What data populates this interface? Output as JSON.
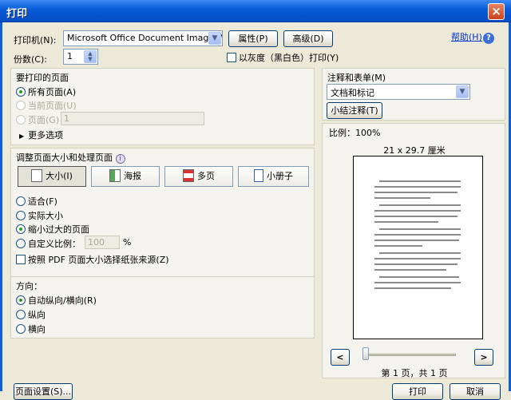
{
  "window": {
    "title": "打印",
    "close": "×"
  },
  "printer": {
    "label": "打印机(N):",
    "value": "Microsoft Office Document Image Writer",
    "properties": "属性(P)",
    "advanced": "高级(D)",
    "help": "帮助(H)"
  },
  "copies": {
    "label": "份数(C):",
    "value": "1"
  },
  "grayscale": {
    "label": "以灰度（黑白色）打印(Y)"
  },
  "pages": {
    "title": "要打印的页面",
    "all": "所有页面(A)",
    "current": "当前页面(U)",
    "range": "页面(G)",
    "range_value": "1",
    "more": "更多选项"
  },
  "sizing": {
    "title": "调整页面大小和处理页面",
    "tiles": [
      "大小(I)",
      "海报",
      "多页",
      "小册子"
    ],
    "fit": "适合(F)",
    "actual": "实际大小",
    "shrink": "缩小过大的页面",
    "custom": "自定义比例：",
    "custom_value": "100",
    "percent": "%",
    "pdf_paper": "按照 PDF 页面大小选择纸张来源(Z)"
  },
  "orientation": {
    "title": "方向：",
    "auto": "自动纵向/横向(R)",
    "portrait": "纵向",
    "landscape": "横向"
  },
  "comments": {
    "title": "注释和表单(M)",
    "value": "文档和标记",
    "summarize": "小结注释(T)"
  },
  "preview": {
    "scale": "比例：100%",
    "size": "21 x 29.7 厘米",
    "prev": "<",
    "next": ">",
    "page_status": "第 1 页，共 1 页"
  },
  "footer": {
    "page_setup": "页面设置(S)...",
    "print": "打印",
    "cancel": "取消"
  }
}
